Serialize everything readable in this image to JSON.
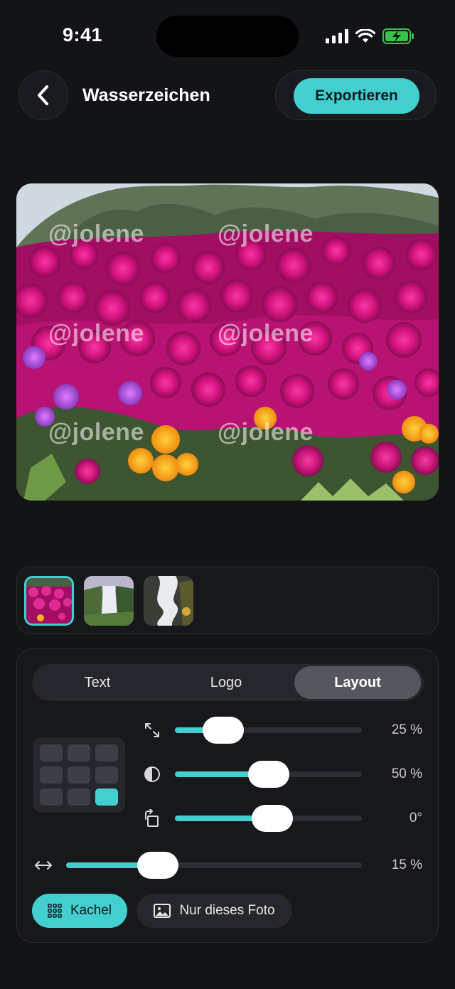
{
  "status_bar": {
    "time": "9:41"
  },
  "header": {
    "title": "Wasserzeichen",
    "export_label": "Exportieren"
  },
  "preview": {
    "watermark_text": "@jolene"
  },
  "thumbnails": [
    {
      "name": "flowers",
      "selected": true
    },
    {
      "name": "waterfall",
      "selected": false
    },
    {
      "name": "river",
      "selected": false
    }
  ],
  "tabs": [
    {
      "label": "Text",
      "active": false
    },
    {
      "label": "Logo",
      "active": false
    },
    {
      "label": "Layout",
      "active": true
    }
  ],
  "position_grid": {
    "rows": 3,
    "cols": 3,
    "selected": "bottom-right"
  },
  "sliders": [
    {
      "name": "size",
      "icon": "resize-icon",
      "value": 25,
      "display": "25 %"
    },
    {
      "name": "opacity",
      "icon": "opacity-icon",
      "value": 50,
      "display": "50 %"
    },
    {
      "name": "rotation",
      "icon": "rotate-icon",
      "value": 0,
      "display": "0°"
    },
    {
      "name": "spacing",
      "icon": "spacing-icon",
      "value": 15,
      "display": "15 %"
    }
  ],
  "mode": {
    "tile_label": "Kachel",
    "single_label": "Nur dieses Foto",
    "selected": "tile"
  },
  "colors": {
    "accent": "#43cfcf",
    "background": "#131418",
    "panel": "#17181c"
  }
}
